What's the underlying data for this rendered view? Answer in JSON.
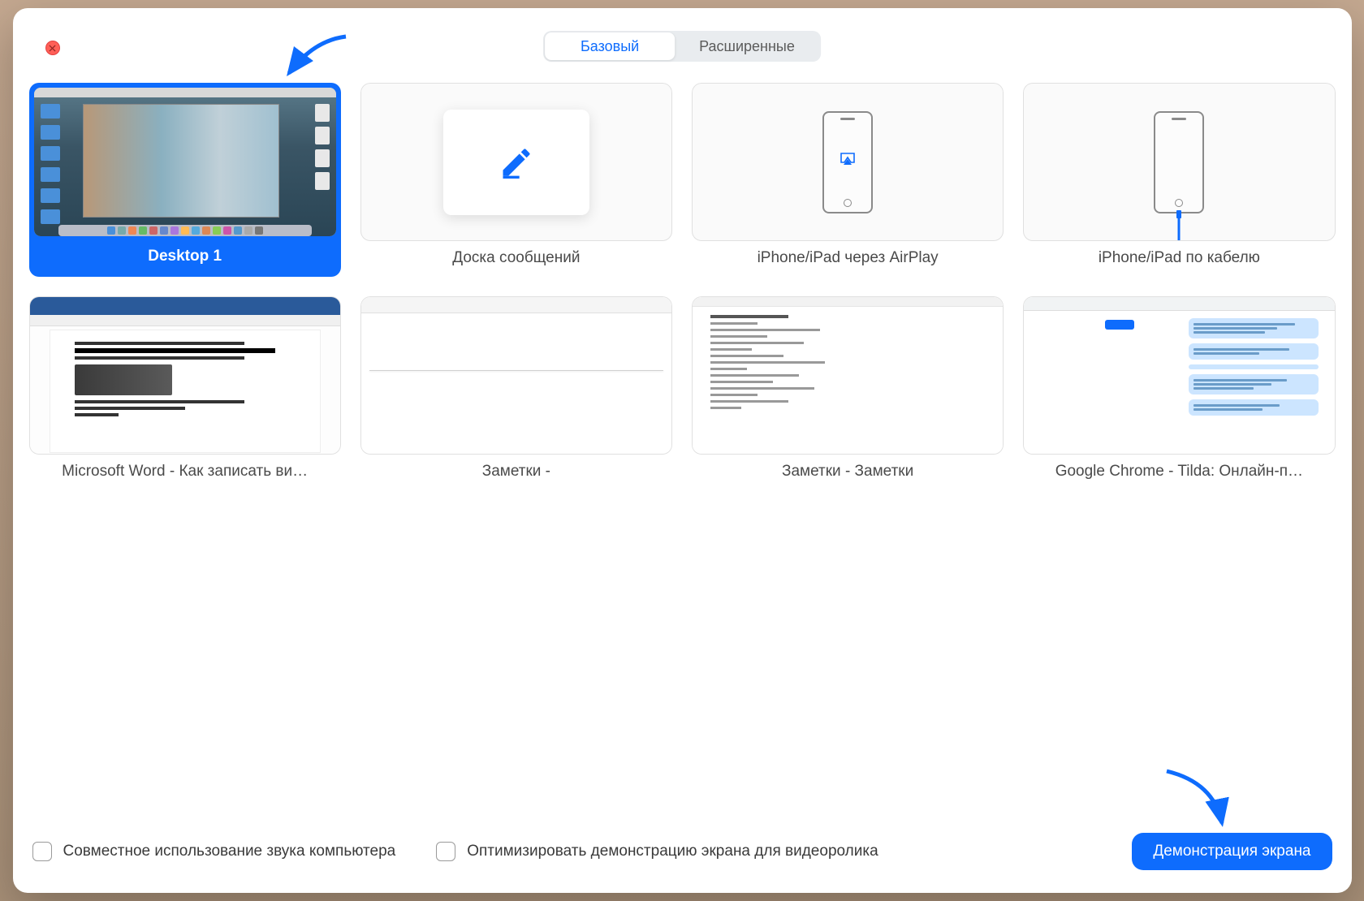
{
  "tabs": {
    "basic": "Базовый",
    "advanced": "Расширенные"
  },
  "sources": {
    "desktop1": {
      "label": "Desktop 1"
    },
    "whiteboard": {
      "label": "Доска сообщений"
    },
    "airplay": {
      "label": "iPhone/iPad через AirPlay"
    },
    "cable": {
      "label": "iPhone/iPad по кабелю"
    },
    "word": {
      "label": "Microsoft Word - Как записать ви…"
    },
    "notes1": {
      "label": "Заметки -"
    },
    "notes2": {
      "label": "Заметки - Заметки"
    },
    "chrome": {
      "label": "Google Chrome - Tilda: Онлайн-п…"
    }
  },
  "bottom": {
    "share_audio": "Совместное использование звука компьютера",
    "optimize_video": "Оптимизировать демонстрацию экрана для видеоролика",
    "share_button": "Демонстрация экрана"
  },
  "colors": {
    "accent": "#0e6cfd"
  }
}
